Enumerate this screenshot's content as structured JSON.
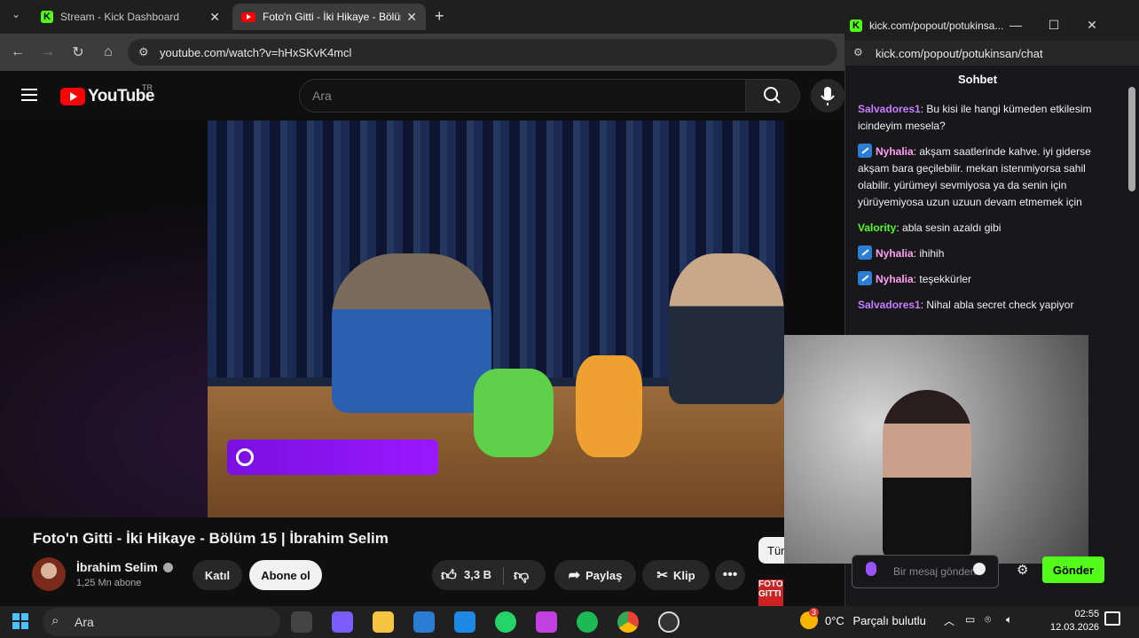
{
  "browser": {
    "tabs": [
      {
        "title": "Stream - Kick Dashboard"
      },
      {
        "title": "Foto'n Gitti - İki Hikaye - Bölüm"
      }
    ],
    "url": "youtube.com/watch?v=hHxSKvK4mcl"
  },
  "youtube": {
    "brand": "YouTube",
    "region": "TR",
    "search_placeholder": "Ara",
    "video_title": "Foto'n Gitti - İki Hikaye - Bölüm 15 | İbrahim Selim",
    "channel_name": "İbrahim Selim",
    "subscribers": "1,25 Mn abone",
    "join_label": "Katıl",
    "subscribe_label": "Abone ol",
    "likes": "3,3 B",
    "share_label": "Paylaş",
    "clip_label": "Klip",
    "chip_label": "Tüm",
    "next_thumb_text": "FOTO'N GITTI"
  },
  "chat": {
    "window_title": "kick.com/popout/potukinsa...",
    "url": "kick.com/popout/potukinsan/chat",
    "header": "Sohbet",
    "messages": [
      {
        "user": "Salvadores1",
        "color": "#c77dff",
        "badge": false,
        "text": "Bu kisi ile hangi kümeden etkilesim icindeyim mesela?"
      },
      {
        "user": "Nyhalia",
        "color": "#ff9ff3",
        "badge": true,
        "text": "akşam saatlerinde kahve. iyi giderse akşam bara geçilebilir. mekan istenmiyorsa sahil olabilir. yürümeyi sevmiyosa ya da senin için yürüyemiyosa uzun uzuun devam etmemek için"
      },
      {
        "user": "Valority",
        "color": "#53fc18",
        "badge": false,
        "text": "abla sesin azaldı gibi"
      },
      {
        "user": "Nyhalia",
        "color": "#ff9ff3",
        "badge": true,
        "text": "ihihih"
      },
      {
        "user": "Nyhalia",
        "color": "#ff9ff3",
        "badge": true,
        "text": "teşekkürler"
      },
      {
        "user": "Salvadores1",
        "color": "#c77dff",
        "badge": false,
        "text": "Nihal abla secret check yapiyor"
      }
    ],
    "input_placeholder": "Bir mesaj gönderin",
    "send_label": "Gönder"
  },
  "taskbar": {
    "search_placeholder": "Ara",
    "temperature": "0°C",
    "weather": "Parçalı bulutlu",
    "time": "02:55",
    "date": "12.03.2026",
    "notification_count": "3"
  }
}
